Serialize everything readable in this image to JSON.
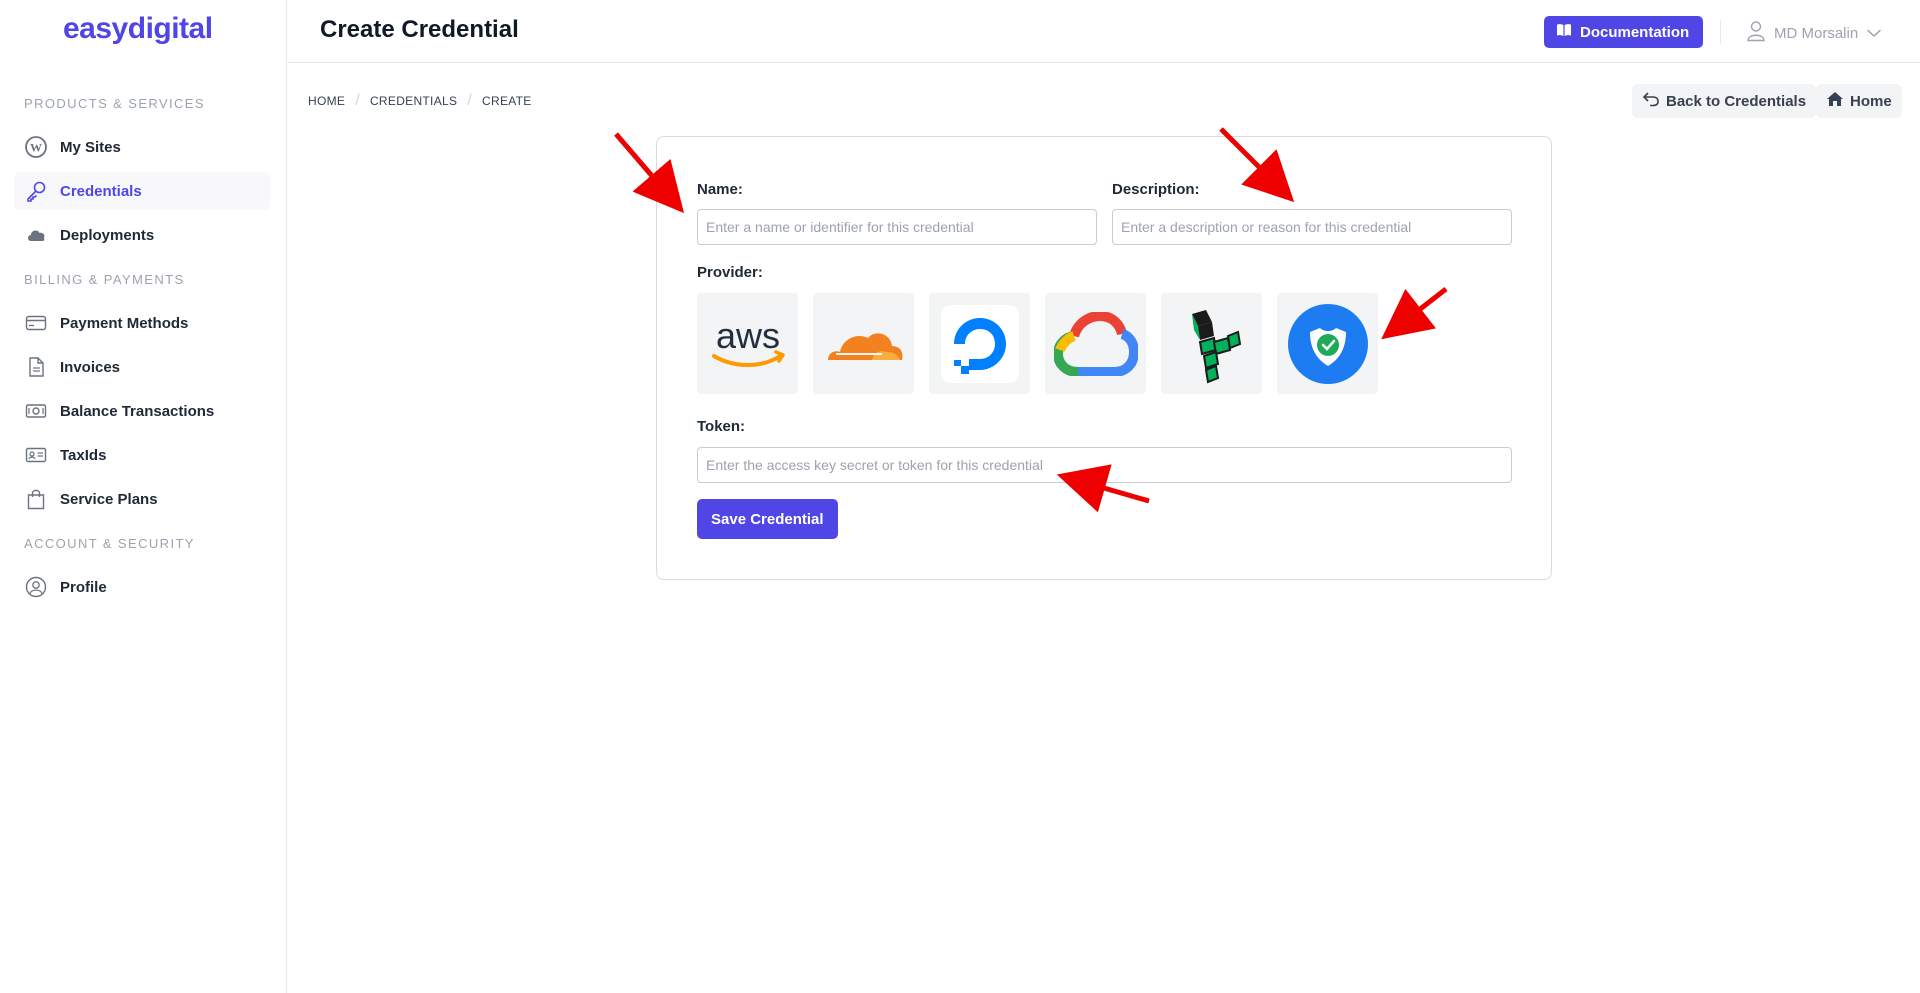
{
  "brand": {
    "logo": "easydigital",
    "accent": "#4f46e5"
  },
  "sidebar": {
    "sections": [
      {
        "label": "PRODUCTS & SERVICES"
      },
      {
        "label": "BILLING & PAYMENTS"
      },
      {
        "label": "ACCOUNT & SECURITY"
      }
    ],
    "items": [
      {
        "label": "My Sites",
        "icon": "wordpress-icon"
      },
      {
        "label": "Credentials",
        "icon": "key-icon",
        "active": true
      },
      {
        "label": "Deployments",
        "icon": "cloud-icon"
      },
      {
        "label": "Payment Methods",
        "icon": "credit-card-icon"
      },
      {
        "label": "Invoices",
        "icon": "document-icon"
      },
      {
        "label": "Balance Transactions",
        "icon": "banknote-icon"
      },
      {
        "label": "TaxIds",
        "icon": "id-card-icon"
      },
      {
        "label": "Service Plans",
        "icon": "shopping-bag-icon"
      },
      {
        "label": "Profile",
        "icon": "user-circle-icon"
      }
    ]
  },
  "header": {
    "title": "Create Credential",
    "documentation_label": "Documentation",
    "user_name": "MD Morsalin"
  },
  "breadcrumb": [
    "HOME",
    "CREDENTIALS",
    "CREATE"
  ],
  "actions": {
    "back_label": "Back to Credentials",
    "home_label": "Home"
  },
  "form": {
    "name_label": "Name:",
    "name_placeholder": "Enter a name or identifier for this credential",
    "description_label": "Description:",
    "description_placeholder": "Enter a description or reason for this credential",
    "provider_label": "Provider:",
    "providers": [
      {
        "name": "aws-logo",
        "text": "aws"
      },
      {
        "name": "cloudflare-logo"
      },
      {
        "name": "digitalocean-logo"
      },
      {
        "name": "google-cloud-logo"
      },
      {
        "name": "linode-logo"
      },
      {
        "name": "shield-check-logo"
      }
    ],
    "token_label": "Token:",
    "token_placeholder": "Enter the access key secret or token for this credential",
    "save_label": "Save Credential"
  },
  "annotation_color": "#ee0000"
}
